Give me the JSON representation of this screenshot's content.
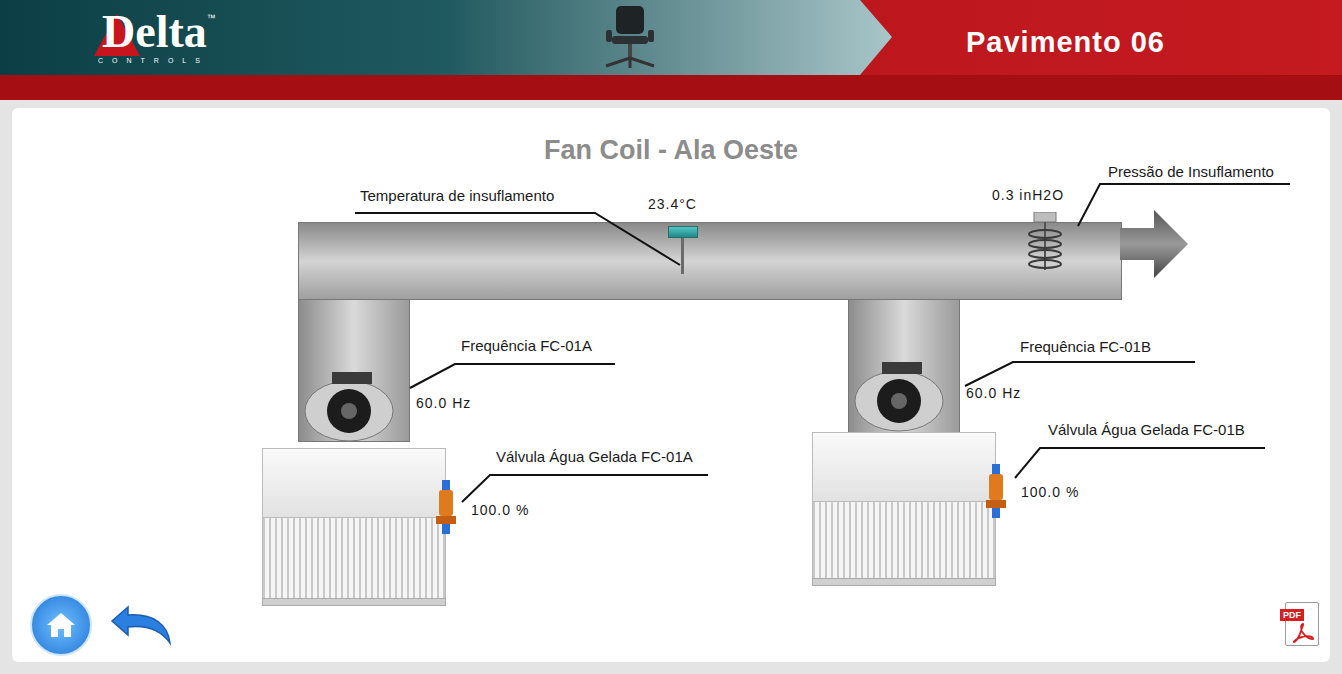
{
  "header": {
    "logo": "Delta",
    "logo_tm": "™",
    "logo_sub": "CONTROLS",
    "title": "Pavimento 06"
  },
  "panel": {
    "title": "Fan Coil - Ala Oeste"
  },
  "sensors": [
    {
      "label": "Temperatura de insuflamento",
      "value": "23.4°C"
    },
    {
      "label": "Pressão de Insuflamento",
      "value": "0.3 inH2O"
    }
  ],
  "units": [
    {
      "frequency_label": "Frequência FC-01A",
      "frequency": "60.0 Hz",
      "valve_label": "Válvula Água Gelada FC-01A",
      "valve": "100.0 %"
    },
    {
      "frequency_label": "Frequência FC-01B",
      "frequency": "60.0 Hz",
      "valve_label": "Válvula Água Gelada FC-01B",
      "valve": "100.0 %"
    }
  ],
  "footer": {
    "pdf": "PDF"
  }
}
